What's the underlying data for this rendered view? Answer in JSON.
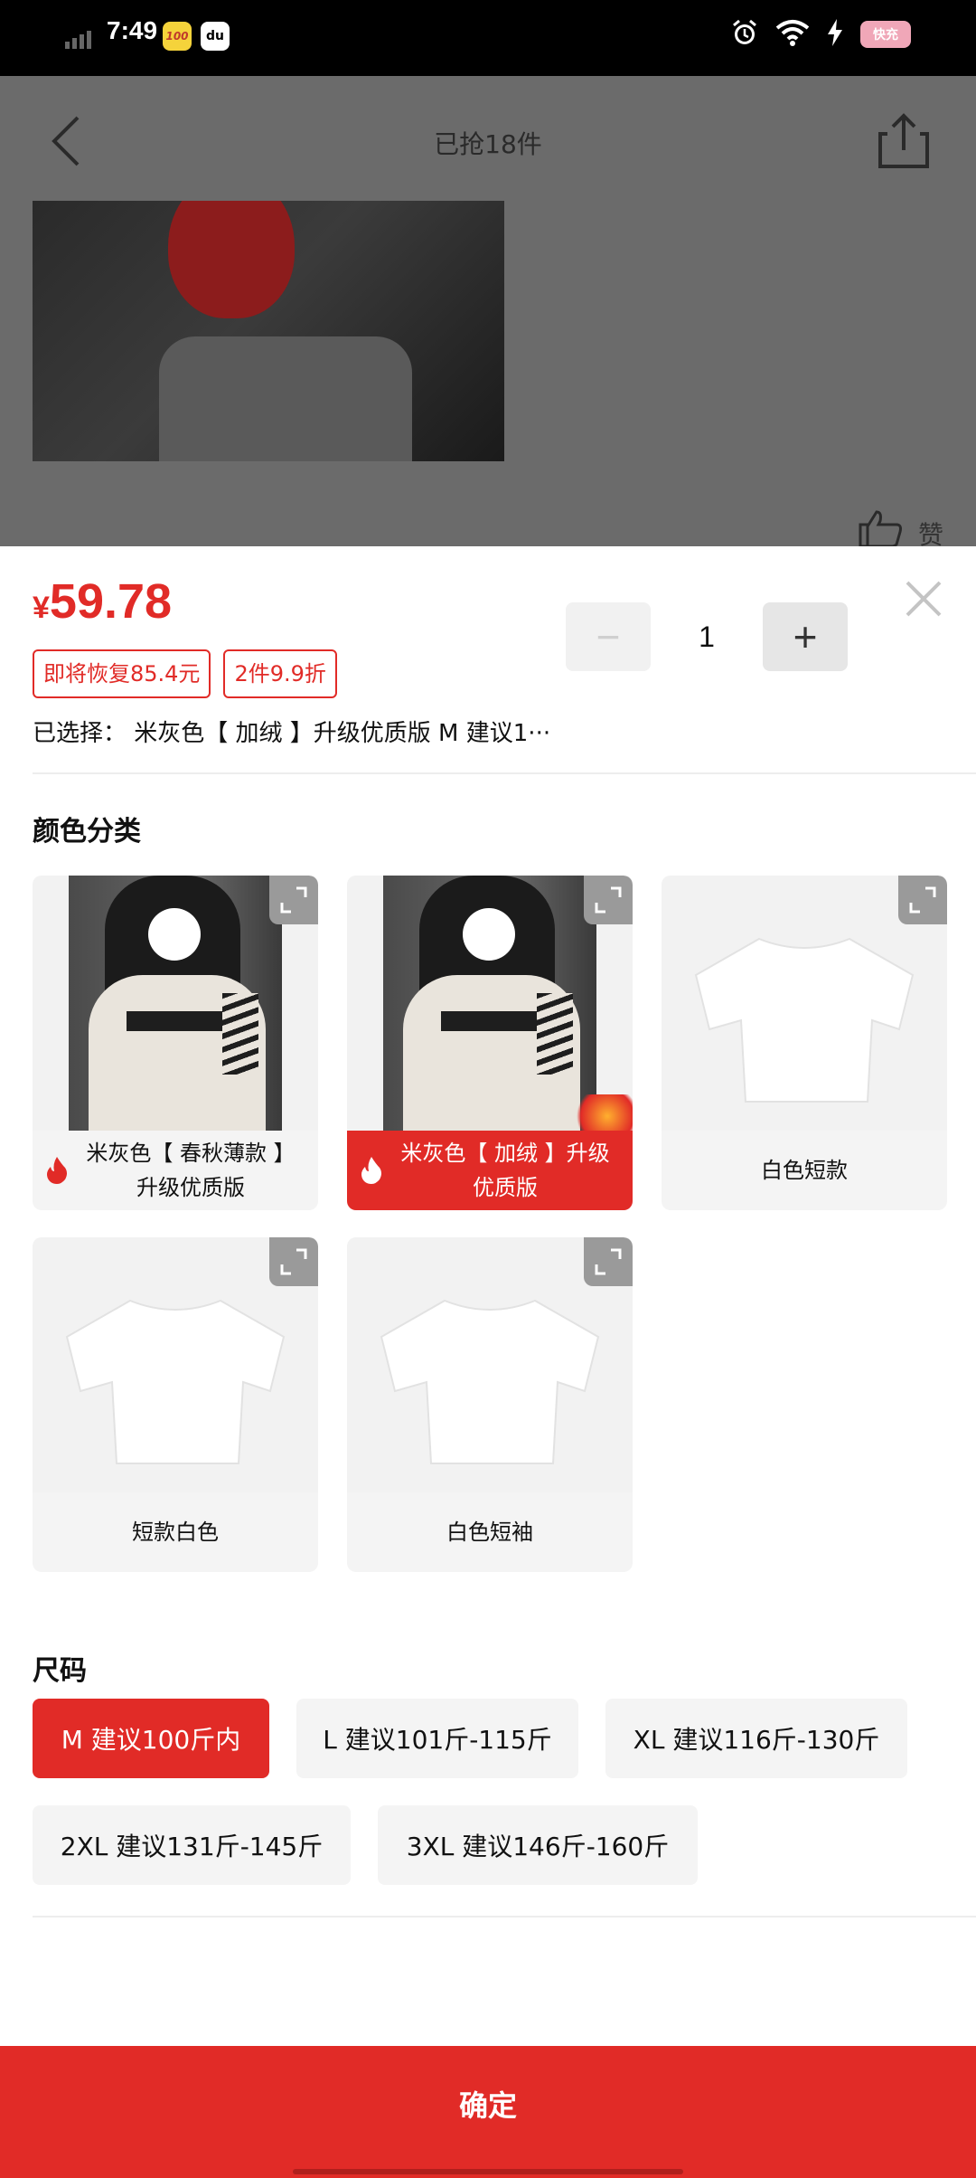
{
  "status_bar": {
    "time": "7:49",
    "app_badge_1": "100",
    "app_badge_2": "du",
    "battery_label": "快充"
  },
  "background_page": {
    "title": "已抢18件",
    "like_label": "赞"
  },
  "sheet": {
    "price_symbol": "¥",
    "price": "59.78",
    "tags": [
      "即将恢复85.4元",
      "2件9.9折"
    ],
    "quantity": "1",
    "minus_label": "−",
    "plus_label": "+",
    "selected_text": "已选择： 米灰色【 加绒 】升级优质版 M 建议1···",
    "color_section_title": "颜色分类",
    "colors": [
      {
        "label": "米灰色【 春秋薄款 】升级优质版",
        "selected": false,
        "hot": true
      },
      {
        "label": "米灰色【 加绒 】升级优质版",
        "selected": true,
        "hot": true
      },
      {
        "label": "白色短款",
        "selected": false,
        "hot": false
      },
      {
        "label": "短款白色",
        "selected": false,
        "hot": false
      },
      {
        "label": "白色短袖",
        "selected": false,
        "hot": false
      }
    ],
    "size_section_title": "尺码",
    "sizes": [
      {
        "label": "M 建议100斤内",
        "selected": true
      },
      {
        "label": "L 建议101斤-115斤",
        "selected": false
      },
      {
        "label": "XL 建议116斤-130斤",
        "selected": false
      },
      {
        "label": "2XL 建议131斤-145斤",
        "selected": false
      },
      {
        "label": "3XL 建议146斤-160斤",
        "selected": false
      }
    ],
    "confirm_label": "确定"
  },
  "colors": {
    "accent": "#e12b27",
    "card_bg": "#f4f4f4",
    "dim_overlay": "#6b6b6b"
  }
}
